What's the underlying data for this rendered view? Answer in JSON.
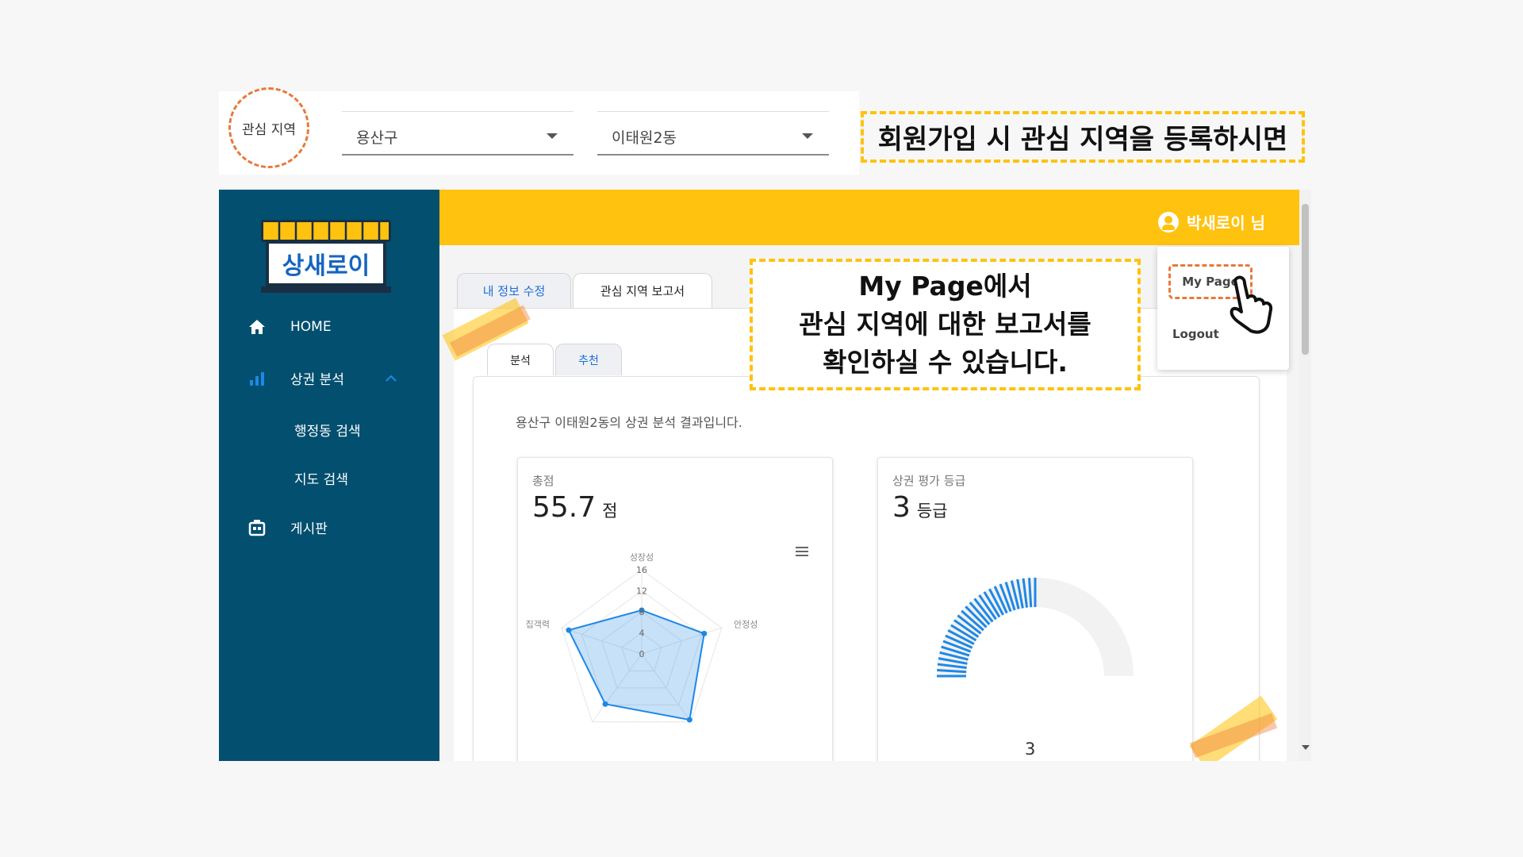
{
  "region_selector": {
    "label": "관심 지역",
    "district": "용산구",
    "dong": "이태원2동",
    "callout": "회원가입 시 관심 지역을 등록하시면"
  },
  "header": {
    "user_name": "박새로이 님"
  },
  "logo_text": "상새로이",
  "sidebar": {
    "items": [
      {
        "label": "HOME",
        "icon": "home-icon"
      },
      {
        "label": "상권 분석",
        "icon": "chart-bars-icon"
      },
      {
        "label": "행정동 검색"
      },
      {
        "label": "지도 검색"
      },
      {
        "label": "게시판",
        "icon": "board-icon"
      }
    ]
  },
  "tabs": {
    "main": [
      "내 정보 수정",
      "관심 지역 보고서"
    ],
    "sub": [
      "분석",
      "추천"
    ]
  },
  "report": {
    "result_text": "용산구 이태원2동의 상권 분석 결과입니다.",
    "total": {
      "label": "총점",
      "value": "55.7",
      "unit": "점"
    },
    "grade": {
      "label": "상권 평가 등급",
      "value": "3",
      "unit": "등급",
      "gauge_value": "3"
    }
  },
  "menu": {
    "my_page": "My Page",
    "logout": "Logout"
  },
  "callout": {
    "lines": [
      "My Page에서",
      "관심 지역에 대한 보고서를",
      "확인하실 수 있습니다."
    ]
  },
  "chart_data": {
    "type": "radar",
    "axes": [
      "성장성",
      "안정성",
      "",
      "",
      "집객력"
    ],
    "ticks": [
      "0",
      "4",
      "8",
      "12",
      "16"
    ],
    "range": [
      0,
      16
    ],
    "values": [
      8.3,
      12.5,
      15.5,
      11.8,
      14.6
    ],
    "color": "#1e88e5"
  },
  "colors": {
    "sidebar": "#034f6f",
    "topbar": "#ffc20e",
    "accent": "#1e88e5",
    "callout_border": "#ffc20e",
    "highlight": "#e8793a"
  }
}
